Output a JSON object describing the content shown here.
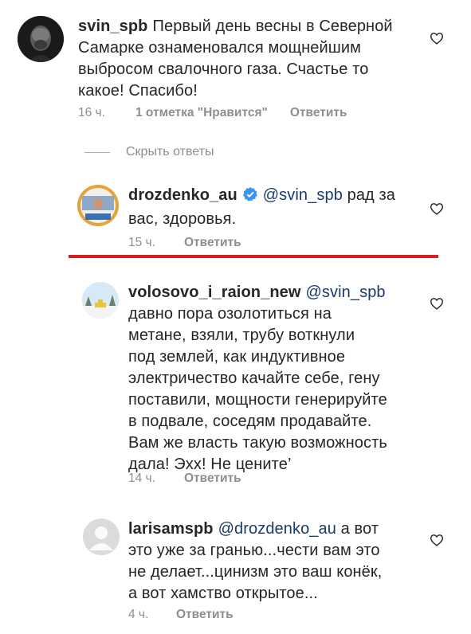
{
  "comments": [
    {
      "username": "svin_spb",
      "text": "Первый день весны в Северной Самарке ознаменовался мощнейшим выбросом свалочного газа. Счастье то какое! Спасибо!",
      "lines": [
        "Первый день весны в Северной",
        "Самарке ознаменовался мощнейшим",
        "выбросом свалочного газа. Счастье то",
        "какое! Спасибо!"
      ],
      "time": "16 ч.",
      "likes": "1 отметка \"Нравится\"",
      "reply": "Ответить"
    },
    {
      "username": "drozdenko_au",
      "verified": true,
      "mention": "@svin_spb",
      "line1_rest": "рад за",
      "line2": "вас, здоровья.",
      "time": "15 ч.",
      "reply": "Ответить"
    },
    {
      "username": "volosovo_i_raion_new",
      "mention": "@svin_spb",
      "lines": [
        "давно пора озолотиться на",
        "метане, взяли, трубу воткнули",
        "под землей, как индуктивное",
        "электричество качайте себе, гену",
        "поставили, мощности генерируйте",
        "в подвале, соседям продавайте.",
        "Вам же власть такую возможность",
        "дала! Эхх! Не цените’"
      ],
      "time": "14 ч.",
      "reply": "Ответить"
    },
    {
      "username": "larisamspb",
      "mention": "@drozdenko_au",
      "line1_rest": "а вот",
      "lines": [
        "это уже за гранью...чести вам это",
        "не делает...цинизм это ваш конёк,",
        "а вот хамство открытое..."
      ],
      "time": "4 ч.",
      "reply": "Ответить"
    }
  ],
  "hide_replies": "Скрыть ответы",
  "colors": {
    "mention": "#1a3a6e",
    "meta": "#8e8e8e",
    "highlight_line": "#d42020",
    "verified": "#3897f0"
  }
}
